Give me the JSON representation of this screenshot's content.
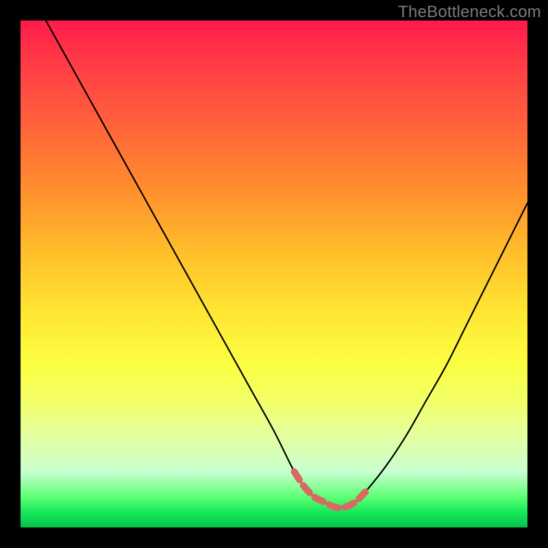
{
  "watermark": "TheBottleneck.com",
  "chart_data": {
    "type": "line",
    "title": "",
    "xlabel": "",
    "ylabel": "",
    "xlim": [
      0,
      100
    ],
    "ylim": [
      0,
      100
    ],
    "series": [
      {
        "name": "curve",
        "color": "#000000",
        "x": [
          5,
          10,
          15,
          20,
          25,
          30,
          35,
          40,
          45,
          50,
          54,
          56,
          58,
          60,
          62,
          64,
          66,
          68,
          72,
          76,
          80,
          84,
          88,
          92,
          96,
          100
        ],
        "y": [
          100,
          91,
          82,
          73,
          64,
          55,
          46,
          37,
          28,
          19,
          11,
          8,
          6,
          5,
          4,
          4,
          5,
          7,
          12,
          18,
          25,
          32,
          40,
          48,
          56,
          64
        ]
      }
    ],
    "highlight": {
      "name": "bottom-segment",
      "color": "#d86a63",
      "x": [
        54,
        56,
        58,
        60,
        62,
        64,
        66,
        68
      ],
      "y": [
        11,
        8,
        6,
        5,
        4,
        4,
        5,
        7
      ]
    }
  }
}
